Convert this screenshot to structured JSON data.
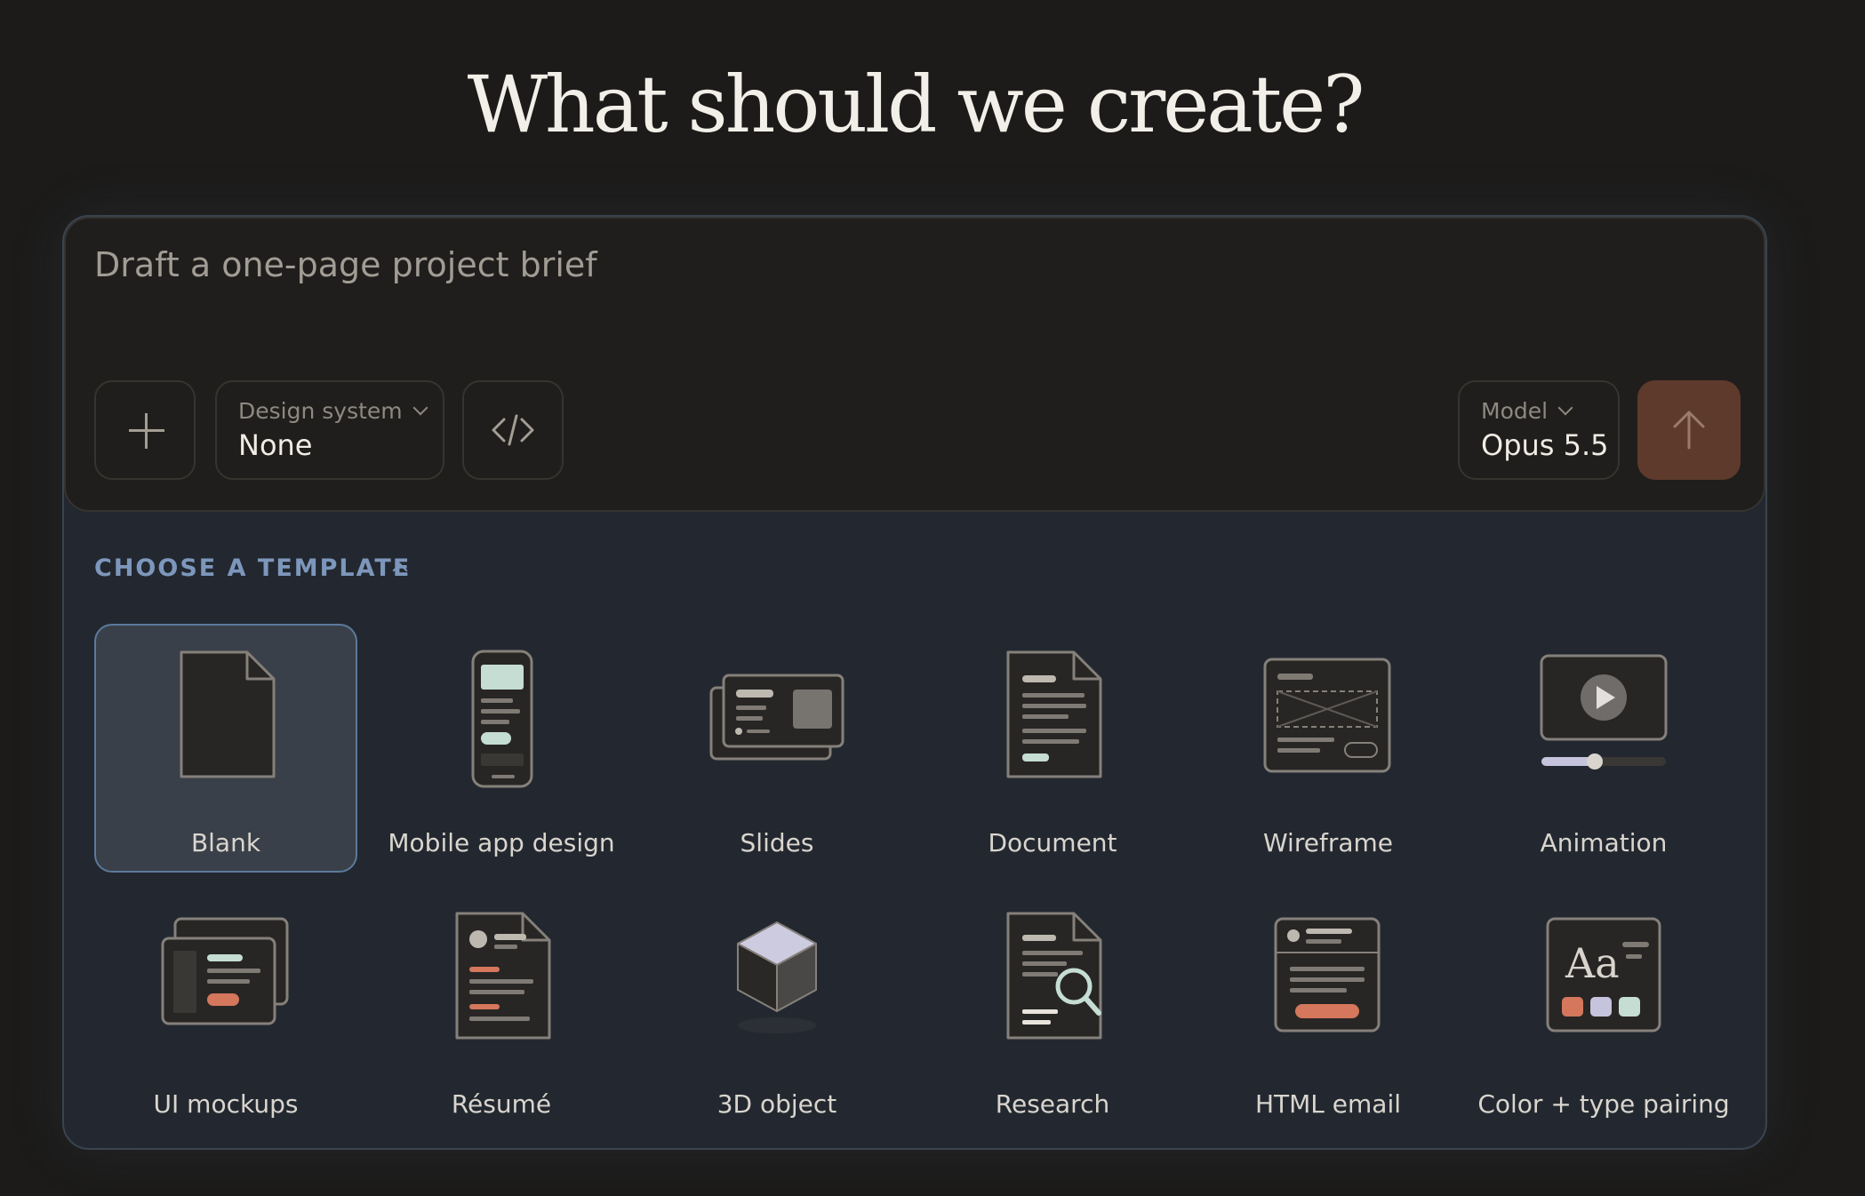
{
  "headline": "What should we create?",
  "prompt": {
    "placeholder": "Draft a one-page project brief"
  },
  "toolbar": {
    "attach_icon": "plus-icon",
    "design_system_label": "Design system",
    "design_system_value": "None",
    "code_icon": "code-icon",
    "model_label": "Model",
    "model_value": "Opus 5.5",
    "send_icon": "arrow-up-icon"
  },
  "templates": {
    "title": "CHOOSE A TEMPLATE",
    "items": [
      {
        "label": "Blank",
        "icon": "blank-page-icon",
        "selected": true
      },
      {
        "label": "Mobile app design",
        "icon": "mobile-phone-icon"
      },
      {
        "label": "Slides",
        "icon": "slides-icon"
      },
      {
        "label": "Document",
        "icon": "document-icon"
      },
      {
        "label": "Wireframe",
        "icon": "wireframe-icon"
      },
      {
        "label": "Animation",
        "icon": "play-icon"
      },
      {
        "label": "UI mockups",
        "icon": "ui-mockups-icon"
      },
      {
        "label": "Résumé",
        "icon": "resume-icon"
      },
      {
        "label": "3D object",
        "icon": "cube-icon"
      },
      {
        "label": "Research",
        "icon": "research-icon"
      },
      {
        "label": "HTML email",
        "icon": "email-icon"
      },
      {
        "label": "Color + type pairing",
        "icon": "color-type-icon"
      }
    ]
  },
  "colors": {
    "accent_orange": "#d4775c",
    "accent_mint": "#c5ddd2",
    "accent_lilac": "#c6c4dc",
    "send_button": "#5e3a2c",
    "section_title": "#7d97bc"
  }
}
